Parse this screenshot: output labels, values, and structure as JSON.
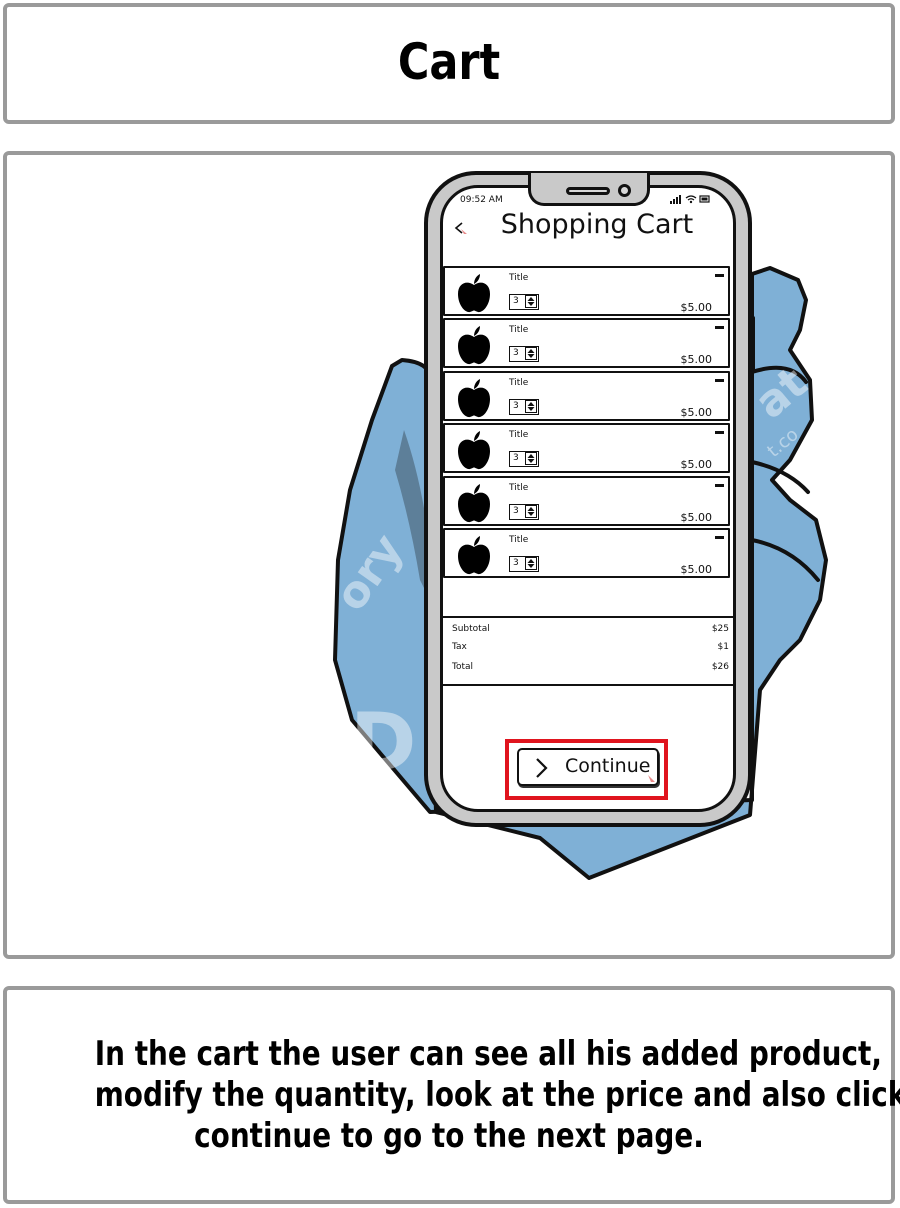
{
  "header": {
    "title": "Cart"
  },
  "phone": {
    "status_time": "09:52 AM",
    "screen_title": "Shopping Cart",
    "items": [
      {
        "title": "Title",
        "quantity": "3",
        "price": "$5.00"
      },
      {
        "title": "Title",
        "quantity": "3",
        "price": "$5.00"
      },
      {
        "title": "Title",
        "quantity": "3",
        "price": "$5.00"
      },
      {
        "title": "Title",
        "quantity": "3",
        "price": "$5.00"
      },
      {
        "title": "Title",
        "quantity": "3",
        "price": "$5.00"
      },
      {
        "title": "Title",
        "quantity": "3",
        "price": "$5.00"
      }
    ],
    "summary": {
      "subtotal_label": "Subtotal",
      "subtotal_value": "$25",
      "tax_label": "Tax",
      "tax_value": "$1",
      "total_label": "Total",
      "total_value": "$26"
    },
    "continue_label": "Continue",
    "icons": [
      "back-arrow-icon",
      "apple-icon",
      "stepper-icon",
      "remove-icon",
      "chevron-right-icon",
      "signal-icon",
      "wifi-icon",
      "battery-icon"
    ]
  },
  "caption": {
    "lines": [
      "In the cart the user can see all his added product,",
      "modify the quantity, look at the price and also click",
      "continue to go to the next page."
    ]
  },
  "colors": {
    "panel_border": "#9a9a9a",
    "hand": "#7fb0d6",
    "hand_shadow": "#5d7f99",
    "phone_frame": "#c9c9c9",
    "highlight": "#e0141e",
    "accent_cursor": "#e88b8b"
  }
}
